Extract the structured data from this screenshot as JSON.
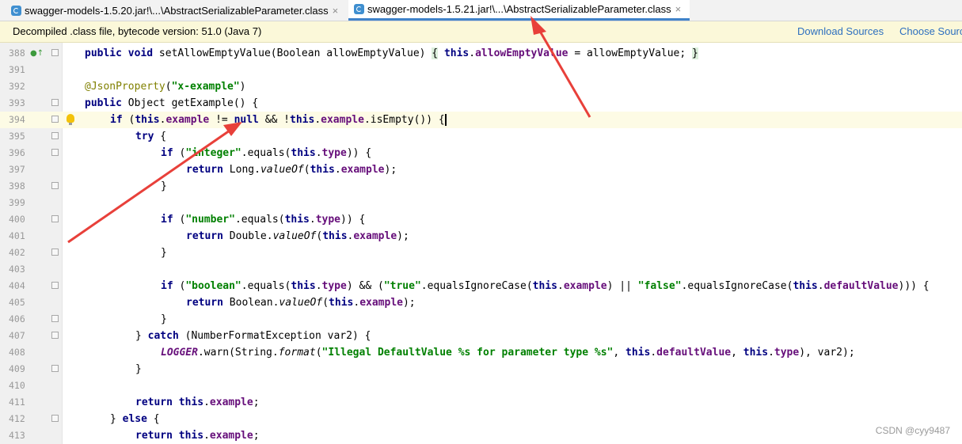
{
  "tabs": [
    {
      "label": "swagger-models-1.5.20.jar!\\...\\AbstractSerializableParameter.class",
      "close": "×",
      "active": false
    },
    {
      "label": "swagger-models-1.5.21.jar!\\...\\AbstractSerializableParameter.class",
      "close": "×",
      "active": true
    }
  ],
  "infobar": {
    "text": "Decompiled .class file, bytecode version: 51.0 (Java 7)",
    "download_sources": "Download Sources",
    "choose_sources": "Choose Sources"
  },
  "code_lines": [
    {
      "n": "388",
      "t": "    public void setAllowEmptyValue(Boolean allowEmptyValue) { this.allowEmptyValue = allowEmptyValue; }"
    },
    {
      "n": "391",
      "t": ""
    },
    {
      "n": "392",
      "t": "    @JsonProperty(\"x-example\")"
    },
    {
      "n": "393",
      "t": "    public Object getExample() {"
    },
    {
      "n": "394",
      "t": "        if (this.example != null && !this.example.isEmpty()) {"
    },
    {
      "n": "395",
      "t": "            try {"
    },
    {
      "n": "396",
      "t": "                if (\"integer\".equals(this.type)) {"
    },
    {
      "n": "397",
      "t": "                    return Long.valueOf(this.example);"
    },
    {
      "n": "398",
      "t": "                }"
    },
    {
      "n": "399",
      "t": ""
    },
    {
      "n": "400",
      "t": "                if (\"number\".equals(this.type)) {"
    },
    {
      "n": "401",
      "t": "                    return Double.valueOf(this.example);"
    },
    {
      "n": "402",
      "t": "                }"
    },
    {
      "n": "403",
      "t": ""
    },
    {
      "n": "404",
      "t": "                if (\"boolean\".equals(this.type) && (\"true\".equalsIgnoreCase(this.example) || \"false\".equalsIgnoreCase(this.defaultValue))) {"
    },
    {
      "n": "405",
      "t": "                    return Boolean.valueOf(this.example);"
    },
    {
      "n": "406",
      "t": "                }"
    },
    {
      "n": "407",
      "t": "            } catch (NumberFormatException var2) {"
    },
    {
      "n": "408",
      "t": "                LOGGER.warn(String.format(\"Illegal DefaultValue %s for parameter type %s\", this.defaultValue, this.type), var2);"
    },
    {
      "n": "409",
      "t": "            }"
    },
    {
      "n": "410",
      "t": ""
    },
    {
      "n": "411",
      "t": "            return this.example;"
    },
    {
      "n": "412",
      "t": "        } else {"
    },
    {
      "n": "413",
      "t": "            return this.example;"
    }
  ],
  "watermark": "CSDN @cyy9487",
  "colors": {
    "keyword": "#000080",
    "string": "#008000",
    "field": "#660e7a",
    "annotation": "#808000",
    "arrow": "#e8403a"
  }
}
